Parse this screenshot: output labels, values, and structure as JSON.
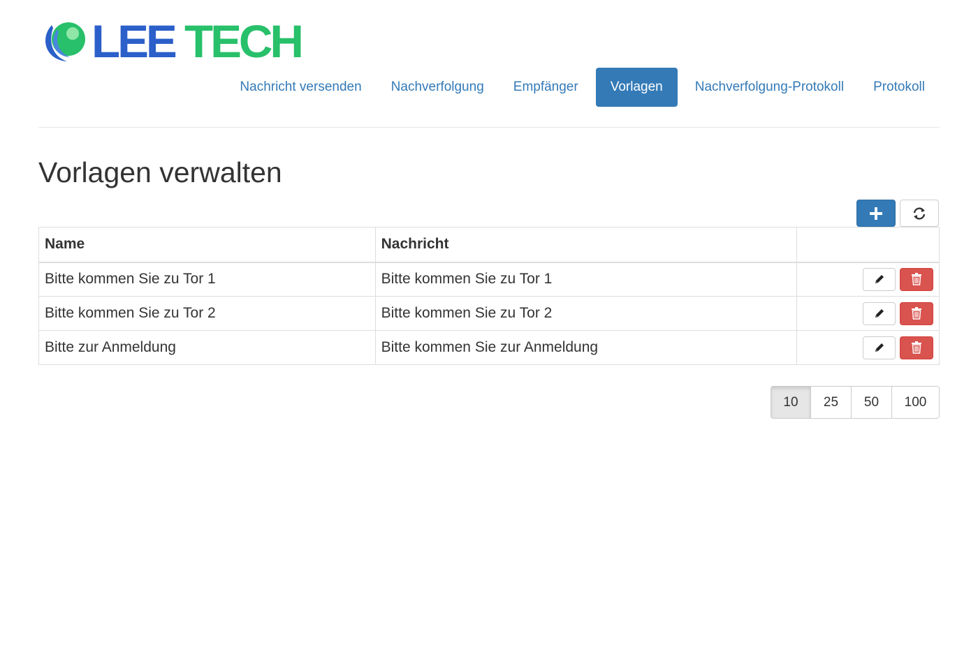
{
  "brand": {
    "logo_part1": "LEE",
    "logo_part2": "TECH",
    "colors": {
      "blue": "#2b5fc9",
      "green": "#28c06a"
    }
  },
  "nav": {
    "items": [
      {
        "label": "Nachricht versenden",
        "active": false
      },
      {
        "label": "Nachverfolgung",
        "active": false
      },
      {
        "label": "Empfänger",
        "active": false
      },
      {
        "label": "Vorlagen",
        "active": true
      },
      {
        "label": "Nachverfolgung-Protokoll",
        "active": false
      },
      {
        "label": "Protokoll",
        "active": false
      }
    ],
    "accent": "#337ab7"
  },
  "page": {
    "title": "Vorlagen verwalten"
  },
  "toolbar": {
    "add_icon": "plus-icon",
    "refresh_icon": "refresh-icon"
  },
  "table": {
    "columns": [
      "Name",
      "Nachricht",
      ""
    ],
    "rows": [
      {
        "name": "Bitte kommen Sie zu Tor 1",
        "message": "Bitte kommen Sie zu Tor 1"
      },
      {
        "name": "Bitte kommen Sie zu Tor 2",
        "message": "Bitte kommen Sie zu Tor 2"
      },
      {
        "name": "Bitte zur Anmeldung",
        "message": "Bitte kommen Sie zur Anmeldung"
      }
    ],
    "row_actions": {
      "edit_icon": "pencil-icon",
      "delete_icon": "trash-icon"
    }
  },
  "pager": {
    "sizes": [
      "10",
      "25",
      "50",
      "100"
    ],
    "selected": "10"
  }
}
